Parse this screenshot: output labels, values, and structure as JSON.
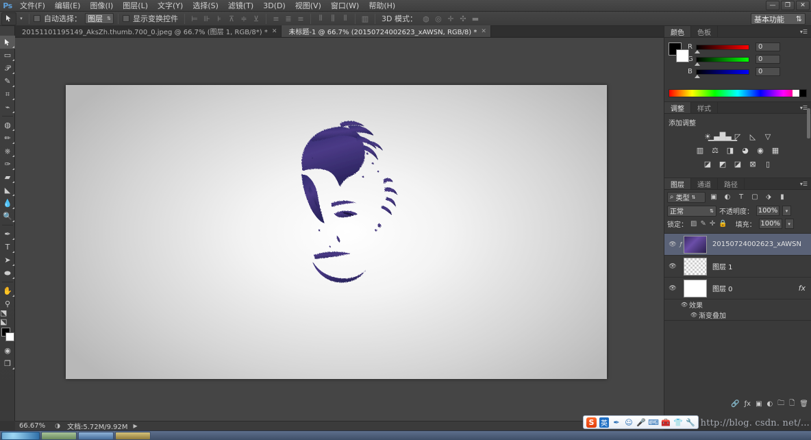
{
  "app": {
    "logo": "Ps",
    "window_controls": {
      "minimize": "—",
      "restore": "❐",
      "close": "✕"
    }
  },
  "menubar": {
    "items": [
      {
        "label": "文件(F)"
      },
      {
        "label": "编辑(E)"
      },
      {
        "label": "图像(I)"
      },
      {
        "label": "图层(L)"
      },
      {
        "label": "文字(Y)"
      },
      {
        "label": "选择(S)"
      },
      {
        "label": "滤镜(T)"
      },
      {
        "label": "3D(D)"
      },
      {
        "label": "视图(V)"
      },
      {
        "label": "窗口(W)"
      },
      {
        "label": "帮助(H)"
      }
    ]
  },
  "options_bar": {
    "tool_icon": "move-tool-icon",
    "auto_select_label": "自动选择：",
    "auto_select_value": "图层",
    "show_transform_label": "显示变换控件",
    "mode_3d_label": "3D 模式：",
    "workspace": "基本功能"
  },
  "tabs": [
    {
      "label": "20151101195149_AksZh.thumb.700_0.jpeg @ 66.7% (图层 1, RGB/8*) *",
      "close": "✕",
      "active": false
    },
    {
      "label": "未标题-1 @ 66.7% (20150724002623_xAWSN, RGB/8) *",
      "close": "✕",
      "active": true
    }
  ],
  "toolbar": {
    "tools": [
      {
        "name": "move-tool",
        "glyph": "⊹",
        "selected": true
      },
      {
        "name": "marquee-tool",
        "glyph": "▭",
        "selected": false
      },
      {
        "name": "lasso-tool",
        "glyph": "◠",
        "selected": false
      },
      {
        "name": "quick-selection-tool",
        "glyph": "✎",
        "selected": false
      },
      {
        "name": "crop-tool",
        "glyph": "⌗",
        "selected": false
      },
      {
        "name": "eyedropper-tool",
        "glyph": "⟋",
        "selected": false
      },
      {
        "name": "spot-healing-tool",
        "glyph": "◍",
        "selected": false
      },
      {
        "name": "brush-tool",
        "glyph": "✐",
        "selected": false
      },
      {
        "name": "clone-stamp-tool",
        "glyph": "⎙",
        "selected": false
      },
      {
        "name": "history-brush-tool",
        "glyph": "✑",
        "selected": false
      },
      {
        "name": "eraser-tool",
        "glyph": "▱",
        "selected": false
      },
      {
        "name": "gradient-tool",
        "glyph": "▤",
        "selected": false
      },
      {
        "name": "blur-tool",
        "glyph": "◔",
        "selected": false
      },
      {
        "name": "dodge-tool",
        "glyph": "⚲",
        "selected": false
      },
      {
        "name": "pen-tool",
        "glyph": "✒",
        "selected": false
      },
      {
        "name": "type-tool",
        "glyph": "T",
        "selected": false
      },
      {
        "name": "path-selection-tool",
        "glyph": "➤",
        "selected": false
      },
      {
        "name": "ellipse-shape-tool",
        "glyph": "⬭",
        "selected": false
      },
      {
        "name": "hand-tool",
        "glyph": "✋",
        "selected": false
      },
      {
        "name": "zoom-tool",
        "glyph": "⚲",
        "selected": false
      }
    ],
    "foreground_color": "#000000",
    "background_color": "#ffffff"
  },
  "color_panel": {
    "tabs": [
      {
        "label": "颜色",
        "active": true
      },
      {
        "label": "色板",
        "active": false
      }
    ],
    "channels": [
      {
        "label": "R",
        "value": "0",
        "color": "#ff0000"
      },
      {
        "label": "G",
        "value": "0",
        "color": "#00ff00"
      },
      {
        "label": "B",
        "value": "0",
        "color": "#0000ff"
      }
    ]
  },
  "adjustments_panel": {
    "tabs": [
      {
        "label": "调整",
        "active": true
      },
      {
        "label": "样式",
        "active": false
      }
    ],
    "title": "添加调整",
    "icons": [
      [
        "brightness-contrast-icon",
        "levels-icon",
        "curves-icon",
        "exposure-icon",
        "vibrance-icon"
      ],
      [
        "hue-saturation-icon",
        "color-balance-icon",
        "black-white-icon",
        "photo-filter-icon",
        "channel-mixer-icon",
        "color-lookup-icon"
      ],
      [
        "invert-icon",
        "posterize-icon",
        "threshold-icon",
        "selective-color-icon",
        "gradient-map-icon"
      ]
    ]
  },
  "layers_panel": {
    "tabs": [
      {
        "label": "图层",
        "active": true
      },
      {
        "label": "通道",
        "active": false
      },
      {
        "label": "路径",
        "active": false
      }
    ],
    "filter_label": "类型",
    "blend_mode": "正常",
    "opacity_label": "不透明度：",
    "opacity_value": "100%",
    "lock_label": "锁定：",
    "fill_label": "填充：",
    "fill_value": "100%",
    "layers": [
      {
        "name": "20150724002623_xAWSN",
        "thumb": "space",
        "selected": true,
        "visible": true,
        "linked": true,
        "has_fx": false
      },
      {
        "name": "图层 1",
        "thumb": "checker",
        "selected": false,
        "visible": true,
        "linked": false,
        "has_fx": false
      },
      {
        "name": "图层 0",
        "thumb": "white",
        "selected": false,
        "visible": true,
        "linked": false,
        "has_fx": true,
        "fx_badge": "fx",
        "effects_label": "效果",
        "effect_items": [
          "渐变叠加"
        ]
      }
    ]
  },
  "status_bar": {
    "zoom": "66.67%",
    "doc_label": "文档:5.72M/9.92M",
    "arrow": "▶"
  },
  "ime": {
    "logo": "S",
    "keys": [
      "英"
    ],
    "icons": [
      "pen-icon",
      "smiley-icon",
      "mic-icon",
      "keyboard-icon",
      "toolbox-icon",
      "shirt-icon",
      "wrench-icon"
    ]
  },
  "watermark": {
    "text": "http://blog. csdn. net/..."
  },
  "taskbar": {
    "start_label": "",
    "buttons": [
      "task-1",
      "task-2",
      "task-3",
      "task-4"
    ]
  }
}
